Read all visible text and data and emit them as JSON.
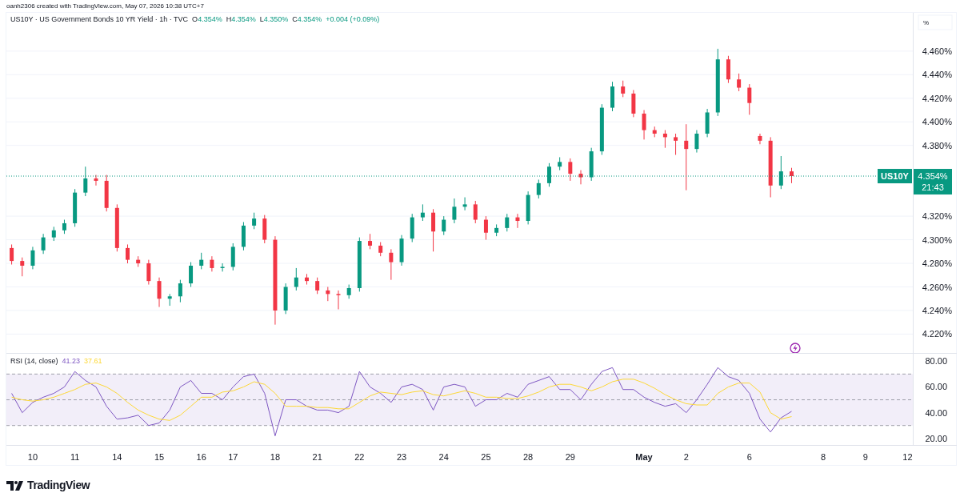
{
  "credit": "oanh2306 created with TradingView.com, May 07, 2026 10:38 UTC+7",
  "price_pane": {
    "legend": {
      "title": "US10Y · US Government Bonds 10 YR Yield · 1h · TVC",
      "values": [
        {
          "key": "O",
          "value": "4.354%"
        },
        {
          "key": "H",
          "value": "4.354%"
        },
        {
          "key": "L",
          "value": "4.350%"
        },
        {
          "key": "C",
          "value": "4.354%"
        }
      ],
      "change": "+0.004 (+0.09%)"
    },
    "unit": "%",
    "last_price": {
      "symbol": "US10Y",
      "countdown": "21:43"
    },
    "chart_data": {
      "type": "candlestick",
      "grid": true,
      "ylim": [
        4.204,
        4.4925
      ],
      "categories": [
        null,
        null,
        null,
        null,
        null,
        null,
        null,
        null,
        null,
        null,
        null,
        null,
        null,
        null,
        null,
        null,
        null,
        null,
        null,
        null,
        null,
        null,
        null,
        null,
        null,
        null,
        null,
        null,
        null,
        null,
        null,
        null,
        null,
        null,
        null,
        null,
        null,
        null,
        null,
        null,
        null,
        null,
        null,
        null,
        null,
        null,
        null,
        null,
        null,
        null,
        null,
        null,
        null,
        null,
        null,
        null,
        null,
        null,
        null,
        null,
        null,
        null,
        null,
        null,
        null,
        null,
        null,
        null,
        null,
        null,
        null,
        null,
        null,
        null,
        null,
        null,
        null,
        null,
        null,
        null,
        null,
        null,
        null,
        null,
        null,
        null
      ],
      "ohlc": [
        [
          4.293,
          4.296,
          4.279,
          4.282
        ],
        [
          4.282,
          4.285,
          4.269,
          4.278
        ],
        [
          4.278,
          4.294,
          4.275,
          4.291
        ],
        [
          4.291,
          4.305,
          4.288,
          4.302
        ],
        [
          4.302,
          4.311,
          4.299,
          4.308
        ],
        [
          4.308,
          4.317,
          4.305,
          4.314
        ],
        [
          4.314,
          4.343,
          4.311,
          4.34
        ],
        [
          4.34,
          4.362,
          4.337,
          4.352
        ],
        [
          4.352,
          4.355,
          4.346,
          4.35
        ],
        [
          4.35,
          4.355,
          4.324,
          4.327
        ],
        [
          4.327,
          4.33,
          4.29,
          4.293
        ],
        [
          4.293,
          4.296,
          4.28,
          4.283
        ],
        [
          4.283,
          4.286,
          4.277,
          4.28
        ],
        [
          4.28,
          4.283,
          4.262,
          4.265
        ],
        [
          4.265,
          4.268,
          4.243,
          4.25
        ],
        [
          4.25,
          4.254,
          4.244,
          4.252
        ],
        [
          4.252,
          4.266,
          4.247,
          4.263
        ],
        [
          4.263,
          4.281,
          4.26,
          4.278
        ],
        [
          4.278,
          4.289,
          4.275,
          4.283
        ],
        [
          4.283,
          4.286,
          4.273,
          4.276
        ],
        [
          4.276,
          4.28,
          4.273,
          4.277
        ],
        [
          4.277,
          4.297,
          4.274,
          4.294
        ],
        [
          4.294,
          4.315,
          4.291,
          4.312
        ],
        [
          4.312,
          4.323,
          4.309,
          4.318
        ],
        [
          4.318,
          4.321,
          4.297,
          4.3
        ],
        [
          4.3,
          4.303,
          4.228,
          4.24
        ],
        [
          4.24,
          4.263,
          4.237,
          4.26
        ],
        [
          4.26,
          4.276,
          4.257,
          4.268
        ],
        [
          4.268,
          4.271,
          4.262,
          4.265
        ],
        [
          4.265,
          4.268,
          4.254,
          4.257
        ],
        [
          4.257,
          4.26,
          4.248,
          4.254
        ],
        [
          4.254,
          4.257,
          4.241,
          4.253
        ],
        [
          4.253,
          4.262,
          4.25,
          4.259
        ],
        [
          4.259,
          4.302,
          4.256,
          4.299
        ],
        [
          4.299,
          4.305,
          4.292,
          4.295
        ],
        [
          4.295,
          4.298,
          4.286,
          4.289
        ],
        [
          4.289,
          4.292,
          4.266,
          4.281
        ],
        [
          4.281,
          4.304,
          4.278,
          4.301
        ],
        [
          4.301,
          4.322,
          4.298,
          4.319
        ],
        [
          4.319,
          4.33,
          4.316,
          4.323
        ],
        [
          4.323,
          4.326,
          4.29,
          4.307
        ],
        [
          4.307,
          4.32,
          4.304,
          4.317
        ],
        [
          4.317,
          4.335,
          4.314,
          4.328
        ],
        [
          4.328,
          4.336,
          4.325,
          4.33
        ],
        [
          4.33,
          4.333,
          4.314,
          4.317
        ],
        [
          4.317,
          4.32,
          4.3,
          4.306
        ],
        [
          4.306,
          4.313,
          4.303,
          4.31
        ],
        [
          4.31,
          4.322,
          4.307,
          4.319
        ],
        [
          4.319,
          4.322,
          4.31,
          4.316
        ],
        [
          4.316,
          4.341,
          4.313,
          4.338
        ],
        [
          4.338,
          4.351,
          4.335,
          4.348
        ],
        [
          4.348,
          4.365,
          4.345,
          4.362
        ],
        [
          4.362,
          4.37,
          4.359,
          4.366
        ],
        [
          4.366,
          4.369,
          4.35,
          4.356
        ],
        [
          4.356,
          4.359,
          4.347,
          4.353
        ],
        [
          4.353,
          4.378,
          4.35,
          4.375
        ],
        [
          4.375,
          4.415,
          4.372,
          4.412
        ],
        [
          4.412,
          4.434,
          4.409,
          4.43
        ],
        [
          4.43,
          4.435,
          4.421,
          4.424
        ],
        [
          4.424,
          4.427,
          4.404,
          4.407
        ],
        [
          4.407,
          4.41,
          4.385,
          4.393
        ],
        [
          4.393,
          4.396,
          4.387,
          4.39
        ],
        [
          4.39,
          4.393,
          4.378,
          4.387
        ],
        [
          4.387,
          4.39,
          4.372,
          4.384
        ],
        [
          4.384,
          4.398,
          4.342,
          4.377
        ],
        [
          4.377,
          4.393,
          4.374,
          4.39
        ],
        [
          4.39,
          4.411,
          4.387,
          4.408
        ],
        [
          4.408,
          4.462,
          4.405,
          4.453
        ],
        [
          4.453,
          4.456,
          4.433,
          4.436
        ],
        [
          4.436,
          4.441,
          4.426,
          4.429
        ],
        [
          4.429,
          4.432,
          4.406,
          4.416
        ],
        [
          4.388,
          4.39,
          4.381,
          4.384
        ],
        [
          4.384,
          4.387,
          4.336,
          4.346
        ],
        [
          4.346,
          4.371,
          4.343,
          4.358
        ],
        [
          4.358,
          4.361,
          4.348,
          4.354
        ],
        null,
        null,
        null,
        null,
        null,
        null,
        null,
        null,
        null,
        null,
        null
      ],
      "yticks": [
        {
          "value": 4.46,
          "label": "4.460%"
        },
        {
          "value": 4.44,
          "label": "4.440%"
        },
        {
          "value": 4.42,
          "label": "4.420%"
        },
        {
          "value": 4.4,
          "label": "4.400%"
        },
        {
          "value": 4.38,
          "label": "4.380%"
        },
        {
          "value": 4.32,
          "label": "4.320%"
        },
        {
          "value": 4.3,
          "label": "4.300%"
        },
        {
          "value": 4.28,
          "label": "4.280%"
        },
        {
          "value": 4.26,
          "label": "4.260%"
        },
        {
          "value": 4.24,
          "label": "4.240%"
        },
        {
          "value": 4.22,
          "label": "4.220%"
        }
      ],
      "ref_lines": [
        {
          "axis": "y",
          "value": 4.354,
          "label": "4.354%"
        }
      ]
    }
  },
  "rsi_pane": {
    "legend": {
      "title": "RSI (14, close)",
      "values": [
        "41.23",
        "37.61"
      ]
    },
    "chart_data": {
      "type": "line",
      "ylim": [
        14.9,
        86.4
      ],
      "categories": [
        null,
        null,
        "10",
        null,
        null,
        null,
        "11",
        null,
        null,
        null,
        "14",
        null,
        null,
        null,
        "15",
        null,
        null,
        null,
        "16",
        null,
        null,
        "17",
        null,
        null,
        null,
        "18",
        null,
        null,
        null,
        "21",
        null,
        null,
        null,
        "22",
        null,
        null,
        null,
        "23",
        null,
        null,
        null,
        "24",
        null,
        null,
        null,
        "25",
        null,
        null,
        null,
        "28",
        null,
        null,
        null,
        "29",
        null,
        null,
        null,
        null,
        null,
        null,
        "May",
        null,
        null,
        null,
        "2",
        null,
        null,
        null,
        null,
        null,
        "6",
        null,
        null,
        null,
        null,
        null,
        null,
        "8",
        null,
        null,
        null,
        "9",
        null,
        null,
        null,
        "12"
      ],
      "series": [
        {
          "color": "#7e57c2",
          "values": [
            55,
            40,
            48,
            52,
            55,
            60,
            72,
            65,
            60,
            45,
            35,
            36,
            38,
            30,
            32,
            42,
            60,
            65,
            55,
            55,
            50,
            60,
            68,
            70,
            55,
            22,
            50,
            50,
            45,
            42,
            42,
            40,
            45,
            72,
            60,
            55,
            48,
            60,
            62,
            58,
            42,
            60,
            62,
            60,
            45,
            50,
            50,
            55,
            52,
            62,
            65,
            68,
            58,
            58,
            50,
            62,
            72,
            75,
            58,
            58,
            52,
            48,
            45,
            47,
            40,
            50,
            62,
            75,
            68,
            65,
            55,
            35,
            25,
            36,
            41,
            null,
            null,
            null,
            null,
            null,
            null,
            null,
            null,
            null,
            null,
            null
          ]
        },
        {
          "color": "#fdd835",
          "values": [
            52,
            50,
            49,
            50,
            52,
            55,
            58,
            62,
            63,
            60,
            55,
            48,
            42,
            38,
            35,
            34,
            38,
            45,
            52,
            52,
            56,
            57,
            60,
            64,
            62,
            55,
            45,
            45,
            45,
            44,
            44,
            43,
            43,
            48,
            53,
            56,
            55,
            54,
            56,
            57,
            54,
            53,
            55,
            57,
            55,
            52,
            52,
            51,
            51,
            53,
            56,
            60,
            62,
            62,
            60,
            57,
            60,
            64,
            66,
            66,
            63,
            59,
            54,
            50,
            47,
            46,
            46,
            55,
            60,
            63,
            63,
            56,
            40,
            35,
            37,
            null,
            null,
            null,
            null,
            null,
            null,
            null,
            null,
            null,
            null,
            null
          ]
        }
      ],
      "yticks": [
        {
          "value": 80,
          "label": "80.00"
        },
        {
          "value": 60,
          "label": "60.00"
        },
        {
          "value": 40,
          "label": "40.00"
        },
        {
          "value": 20,
          "label": "20.00"
        }
      ],
      "ref_lines": [
        {
          "axis": "y",
          "value": 70
        },
        {
          "axis": "y",
          "value": 50
        },
        {
          "axis": "y",
          "value": 30
        }
      ],
      "bands": [
        {
          "axis": "y",
          "from": 30,
          "to": 70
        }
      ]
    }
  },
  "brand": "TradingView"
}
